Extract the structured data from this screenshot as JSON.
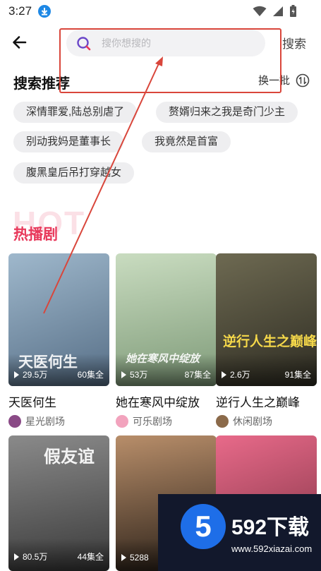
{
  "status_bar": {
    "time": "3:27"
  },
  "header": {
    "search_placeholder": "搜你想搜的",
    "search_button": "搜索"
  },
  "recommend": {
    "title": "搜索推荐",
    "refresh_label": "换一批",
    "chips": [
      "深情罪爱,陆总别虐了",
      "赘婿归来之我是奇门少主",
      "别动我妈是董事长",
      "我竟然是首富",
      "腹黑皇后吊打穿越女"
    ]
  },
  "hot": {
    "deco_text": "HOT",
    "title": "热播剧",
    "dramas": [
      {
        "cover_text": "天医何生",
        "views": "29.5万",
        "episodes": "60集全",
        "title": "天医何生",
        "studio": "星光剧场",
        "cover_color": "#6f90a8",
        "avatar_color": "#8a4a86"
      },
      {
        "cover_text": "她在寒风中绽放",
        "views": "53万",
        "episodes": "87集全",
        "title": "她在寒风中绽放",
        "studio": "可乐剧场",
        "cover_color": "#9fb79a",
        "avatar_color": "#f2a3bd"
      },
      {
        "cover_text": "逆行人生之巅峰",
        "views": "2.6万",
        "episodes": "91集全",
        "title": "逆行人生之巅峰",
        "studio": "休闲剧场",
        "cover_color": "#4c4a3a",
        "avatar_color": "#8b6a4a"
      },
      {
        "cover_text": "假友谊",
        "views": "80.5万",
        "episodes": "44集全",
        "cover_color": "#5b5b5b"
      },
      {
        "cover_text": "",
        "views": "5288",
        "episodes": "",
        "cover_color": "#6a4a3a"
      },
      {
        "cover_text": "",
        "views": "",
        "episodes": "",
        "cover_color": "#d05876"
      }
    ]
  },
  "watermark": {
    "logo_text": "5",
    "brand": "592下载",
    "url": "www.592xiazai.com"
  },
  "colors": {
    "accent": "#e8395b",
    "annotation": "#d9463b",
    "search_icon": "#6a46c8"
  }
}
